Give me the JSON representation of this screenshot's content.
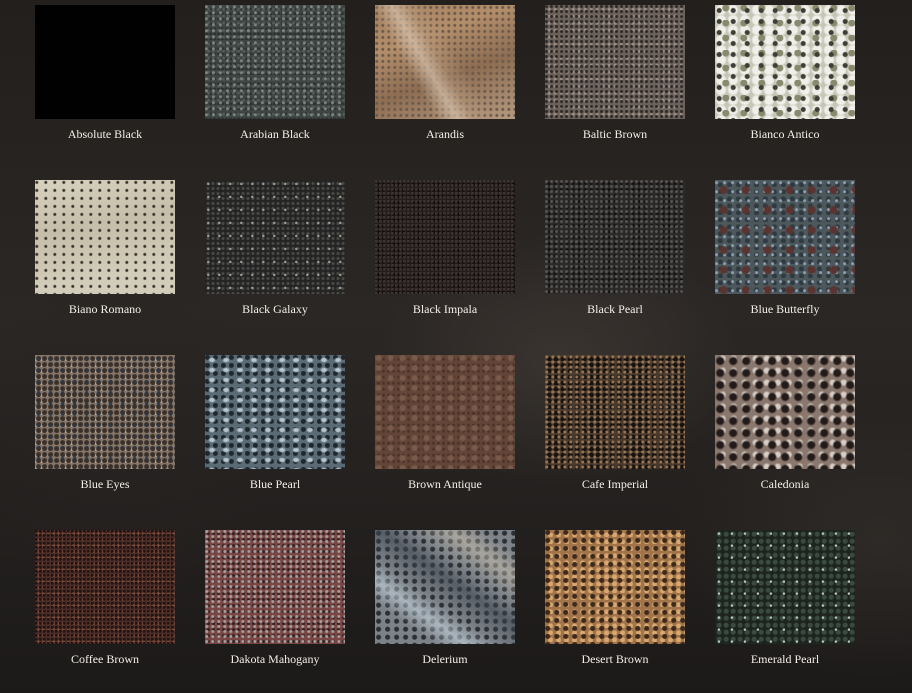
{
  "gallery": {
    "items": [
      {
        "label": "Absolute Black",
        "texture": "absolute-black"
      },
      {
        "label": "Arabian Black",
        "texture": "arabian-black"
      },
      {
        "label": "Arandis",
        "texture": "arandis"
      },
      {
        "label": "Baltic Brown",
        "texture": "baltic-brown"
      },
      {
        "label": "Bianco Antico",
        "texture": "bianco-antico"
      },
      {
        "label": "Biano Romano",
        "texture": "biano-romano"
      },
      {
        "label": "Black Galaxy",
        "texture": "black-galaxy"
      },
      {
        "label": "Black Impala",
        "texture": "black-impala"
      },
      {
        "label": "Black Pearl",
        "texture": "black-pearl"
      },
      {
        "label": "Blue Butterfly",
        "texture": "blue-butterfly"
      },
      {
        "label": "Blue Eyes",
        "texture": "blue-eyes"
      },
      {
        "label": "Blue Pearl",
        "texture": "blue-pearl"
      },
      {
        "label": "Brown Antique",
        "texture": "brown-antique"
      },
      {
        "label": "Cafe Imperial",
        "texture": "cafe-imperial"
      },
      {
        "label": "Caledonia",
        "texture": "caledonia"
      },
      {
        "label": "Coffee Brown",
        "texture": "coffee-brown"
      },
      {
        "label": "Dakota Mahogany",
        "texture": "dakota-mahogany"
      },
      {
        "label": "Delerium",
        "texture": "delerium"
      },
      {
        "label": "Desert Brown",
        "texture": "desert-brown"
      },
      {
        "label": "Emerald Pearl",
        "texture": "emerald-pearl"
      }
    ]
  }
}
